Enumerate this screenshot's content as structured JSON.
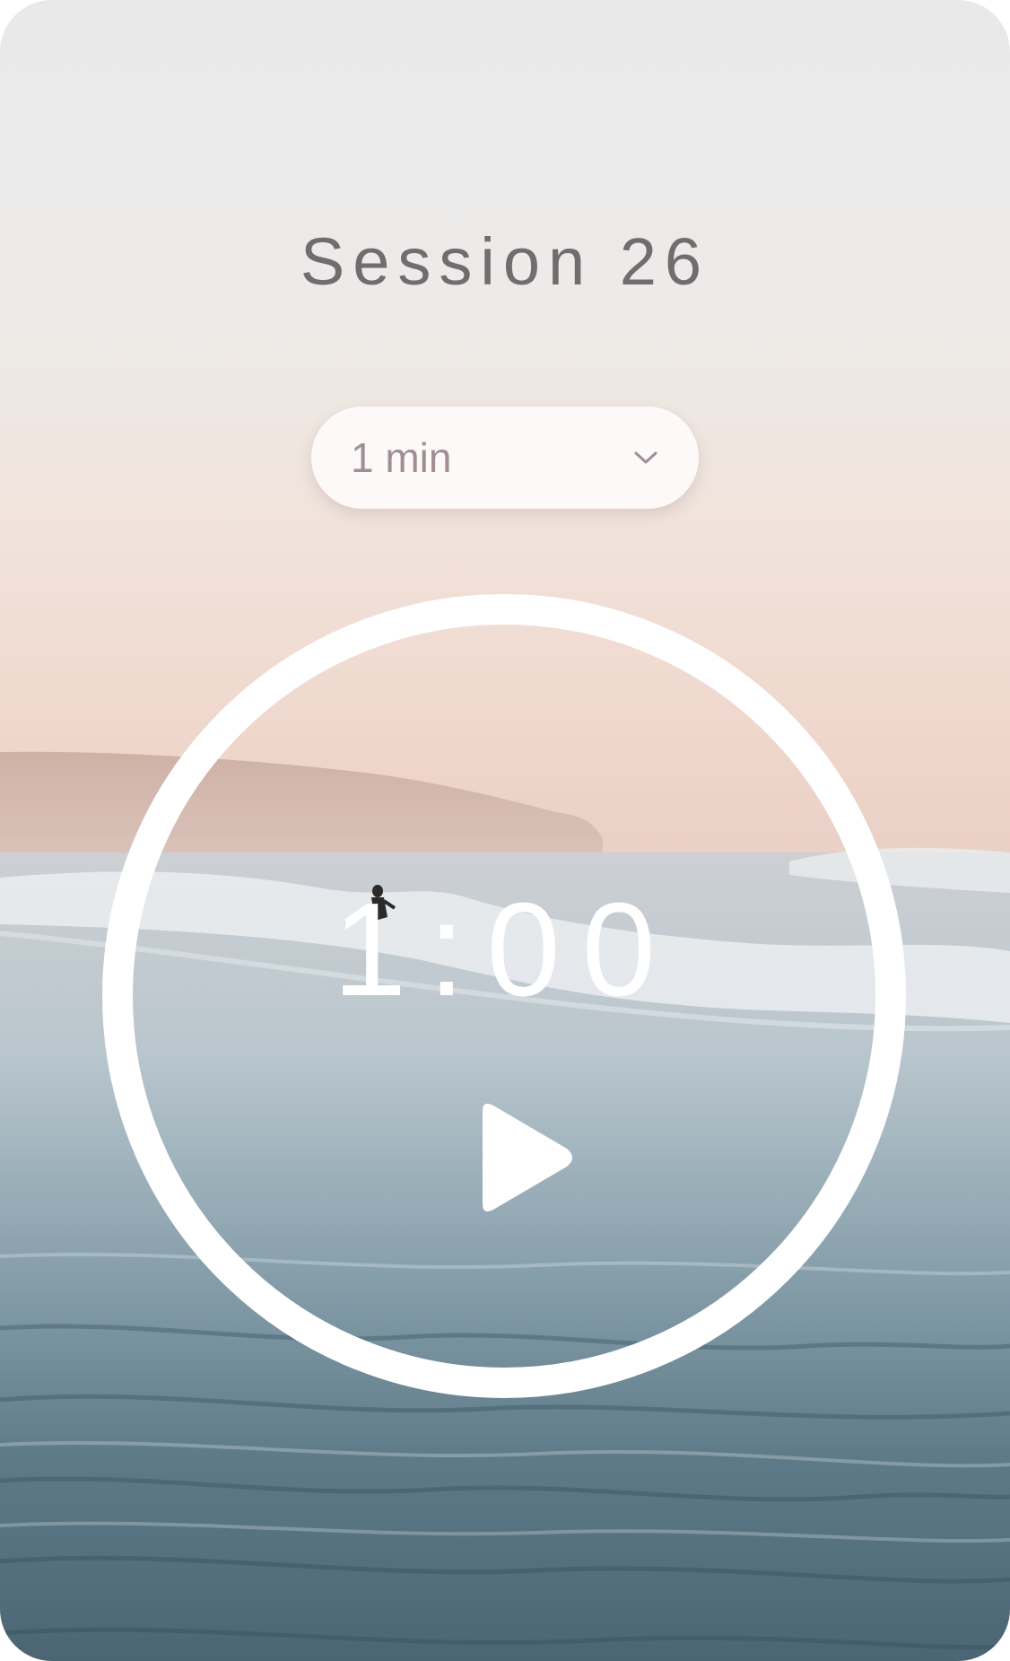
{
  "session": {
    "title": "Session 26"
  },
  "duration_select": {
    "selected": "1 min"
  },
  "timer": {
    "display": "1:00"
  },
  "icons": {
    "dropdown": "chevron-down-icon",
    "play": "play-icon"
  },
  "colors": {
    "title_text": "#6f6d6d",
    "select_text": "#a08e94",
    "ring": "#ffffff",
    "timer_text": "#ffffff"
  }
}
